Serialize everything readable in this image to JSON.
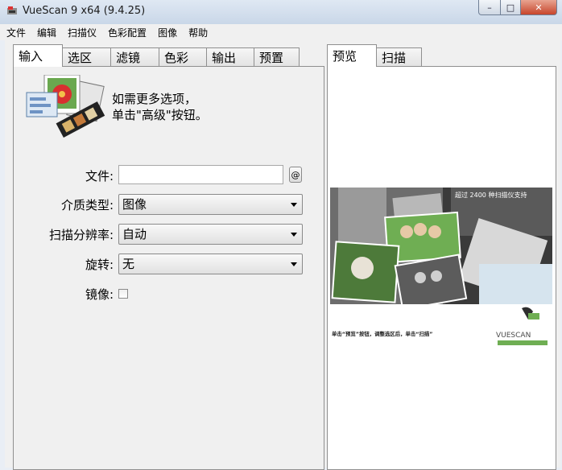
{
  "window": {
    "title": "VueScan 9 x64 (9.4.25)"
  },
  "menu": [
    "文件",
    "编辑",
    "扫描仪",
    "色彩配置",
    "图像",
    "帮助"
  ],
  "left_tabs": [
    "输入",
    "选区",
    "滤镜",
    "色彩",
    "输出",
    "预置"
  ],
  "right_tabs": [
    "预览",
    "扫描"
  ],
  "hint": {
    "line1": "如需更多选项，",
    "line2": "单击\"高级\"按钮。"
  },
  "form": {
    "file_label": "文件:",
    "file_value": "",
    "at_label": "@",
    "media_label": "介质类型:",
    "media_value": "图像",
    "resolution_label": "扫描分辨率:",
    "resolution_value": "自动",
    "rotate_label": "旋转:",
    "rotate_value": "无",
    "mirror_label": "镜像:",
    "mirror_checked": false
  },
  "preview": {
    "banner": "超过 2400 种扫描仪支持",
    "caption": "单击“预览”按钮，调整选区后，单击“扫描”",
    "logo": "VUESCAN"
  }
}
